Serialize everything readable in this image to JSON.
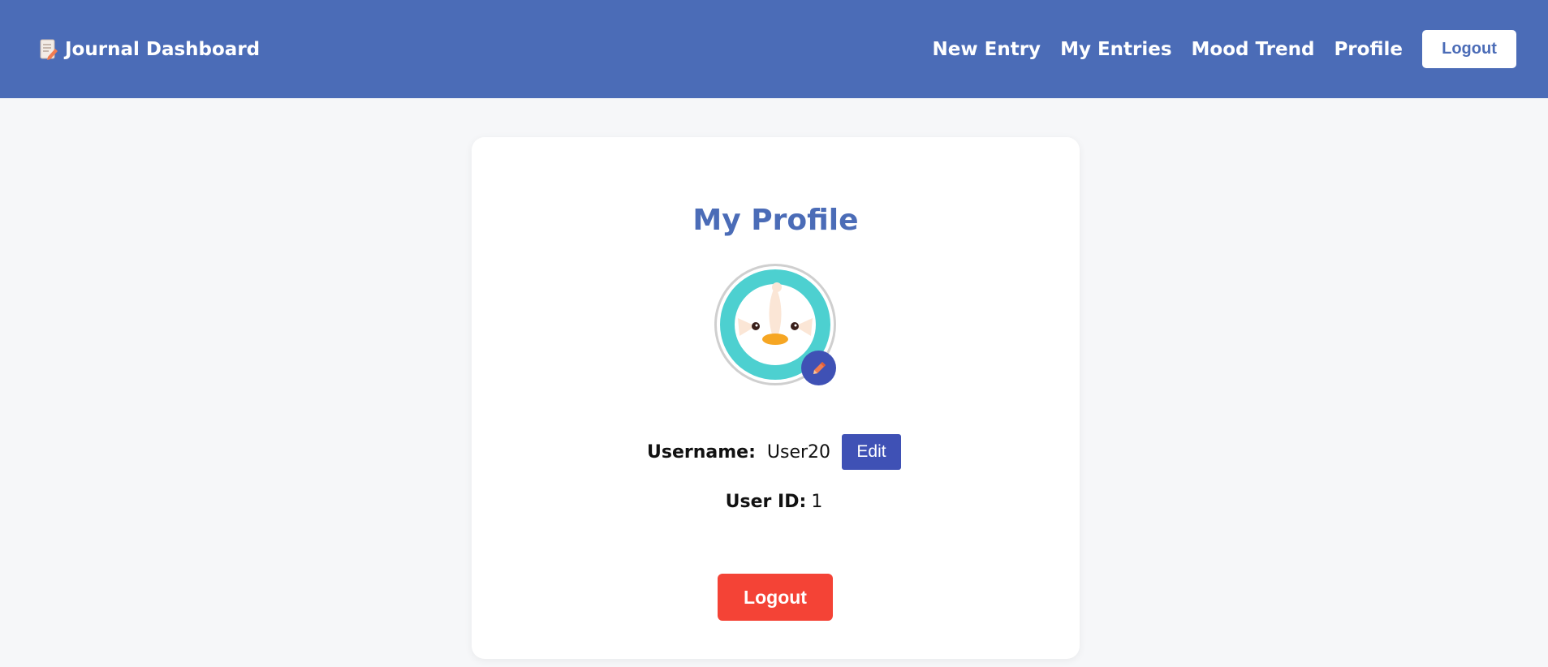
{
  "navbar": {
    "brand_icon": "memo-icon",
    "brand": "Journal Dashboard",
    "links": [
      {
        "label": "New Entry"
      },
      {
        "label": "My Entries"
      },
      {
        "label": "Mood Trend"
      },
      {
        "label": "Profile"
      }
    ],
    "logout_label": "Logout"
  },
  "profile": {
    "title": "My Profile",
    "avatar_icon": "bird-avatar",
    "edit_avatar_icon": "pencil-icon",
    "username_label": "Username:",
    "username": "User20",
    "edit_label": "Edit",
    "user_id_label": "User ID:",
    "user_id": "1",
    "logout_label": "Logout"
  },
  "colors": {
    "navbar": "#4b6cb7",
    "title": "#4b6cb7",
    "edit_button": "#3f51b5",
    "logout_button": "#f44336",
    "avatar_ring": "#4dd0d0"
  }
}
